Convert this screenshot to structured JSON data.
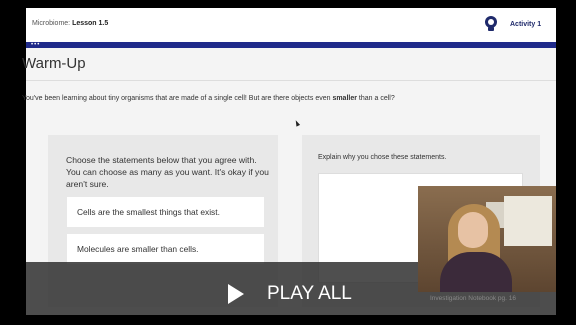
{
  "header": {
    "lesson_prefix": "Microbiome:",
    "lesson_name": "Lesson 1.5",
    "activity": "Activity 1"
  },
  "progress": {
    "dots": "•••"
  },
  "main": {
    "title": "Warm-Up",
    "prompt_before": "You've been learning about tiny organisms that are made of a single cell! But are there objects even ",
    "prompt_emph": "smaller",
    "prompt_after": " than a cell?",
    "left": {
      "instructions": "Choose the statements below that you agree with. You can choose as many as you want. It's okay if you aren't sure.",
      "options": [
        "Cells are the smallest things that exist.",
        "Molecules are smaller than cells."
      ]
    },
    "right": {
      "instructions": "Explain why you chose these statements."
    }
  },
  "overlay": {
    "play_label": "PLAY ALL",
    "timer": "Investigation Notebook pg. 16"
  },
  "colors": {
    "progress_bar": "#1f2a8a",
    "activity_text": "#1f2a6b"
  }
}
